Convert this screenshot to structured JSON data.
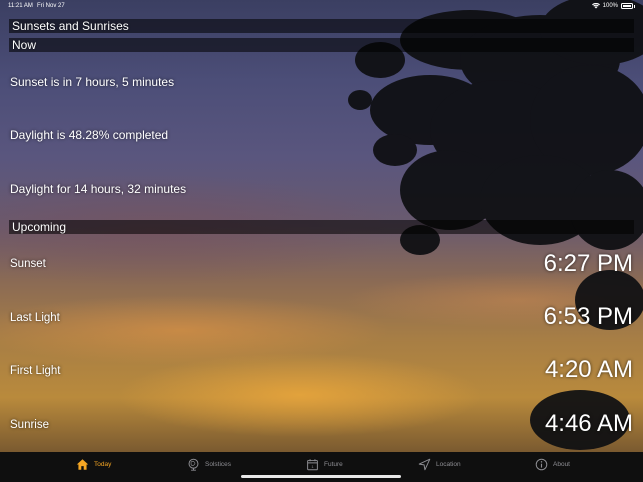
{
  "status_bar": {
    "time": "11:21 AM",
    "date": "Fri Nov 27",
    "battery": "100%"
  },
  "header": {
    "title": "Sunsets and Sunrises"
  },
  "now": {
    "section_label": "Now",
    "sunset_in": "Sunset is in 7 hours, 5 minutes",
    "daylight_completed": "Daylight is 48.28% completed",
    "daylight_for": "Daylight for 14 hours, 32 minutes"
  },
  "upcoming": {
    "section_label": "Upcoming",
    "events": [
      {
        "label": "Sunset",
        "time": "6:27 PM"
      },
      {
        "label": "Last Light",
        "time": "6:53 PM"
      },
      {
        "label": "First Light",
        "time": "4:20 AM"
      },
      {
        "label": "Sunrise",
        "time": "4:46 AM"
      }
    ]
  },
  "tabs": [
    {
      "label": "Today",
      "icon": "home-icon",
      "active": true
    },
    {
      "label": "Solstices",
      "icon": "globe-icon",
      "active": false
    },
    {
      "label": "Future",
      "icon": "calendar-icon",
      "active": false
    },
    {
      "label": "Location",
      "icon": "location-arrow-icon",
      "active": false
    },
    {
      "label": "About",
      "icon": "info-icon",
      "active": false
    }
  ],
  "colors": {
    "accent": "#f5a623",
    "tab_inactive": "#8e8e93",
    "tabbar_bg": "#0f0f0f"
  }
}
